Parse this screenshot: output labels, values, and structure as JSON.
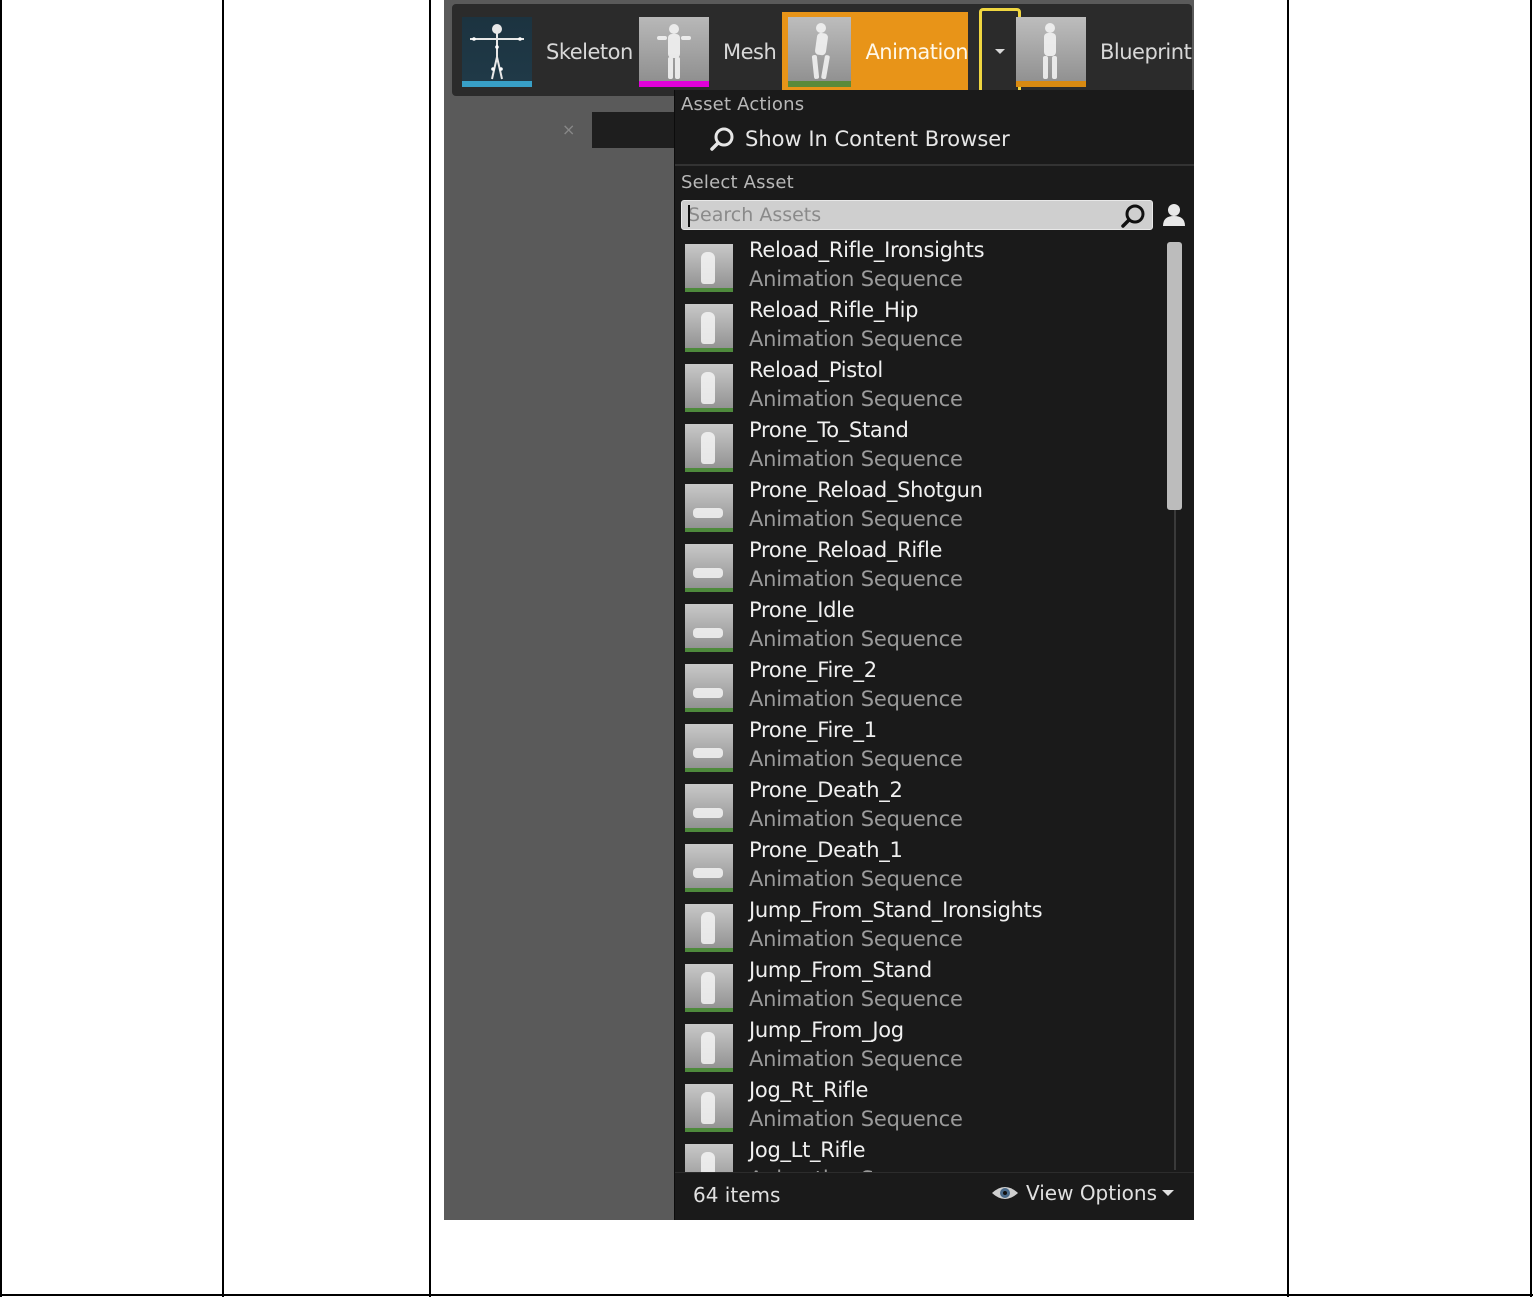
{
  "toolbar": {
    "skeleton_label": "Skeleton",
    "mesh_label": "Mesh",
    "animation_label": "Animation",
    "blueprint_label": "Blueprint",
    "dropdown_icon": "chevron-down-icon"
  },
  "editor": {
    "tab_close": "×"
  },
  "menu": {
    "asset_actions_heading": "Asset Actions",
    "show_in_content_browser": "Show In Content Browser",
    "select_asset_heading": "Select Asset",
    "search_placeholder": "Search Assets",
    "items": [
      {
        "name": "Reload_Rifle_Ironsights",
        "type": "Animation Sequence"
      },
      {
        "name": "Reload_Rifle_Hip",
        "type": "Animation Sequence"
      },
      {
        "name": "Reload_Pistol",
        "type": "Animation Sequence"
      },
      {
        "name": "Prone_To_Stand",
        "type": "Animation Sequence"
      },
      {
        "name": "Prone_Reload_Shotgun",
        "type": "Animation Sequence"
      },
      {
        "name": "Prone_Reload_Rifle",
        "type": "Animation Sequence"
      },
      {
        "name": "Prone_Idle",
        "type": "Animation Sequence"
      },
      {
        "name": "Prone_Fire_2",
        "type": "Animation Sequence"
      },
      {
        "name": "Prone_Fire_1",
        "type": "Animation Sequence"
      },
      {
        "name": "Prone_Death_2",
        "type": "Animation Sequence"
      },
      {
        "name": "Prone_Death_1",
        "type": "Animation Sequence"
      },
      {
        "name": "Jump_From_Stand_Ironsights",
        "type": "Animation Sequence"
      },
      {
        "name": "Jump_From_Stand",
        "type": "Animation Sequence"
      },
      {
        "name": "Jump_From_Jog",
        "type": "Animation Sequence"
      },
      {
        "name": "Jog_Rt_Rifle",
        "type": "Animation Sequence"
      },
      {
        "name": "Jog_Lt_Rifle",
        "type": "Animation Sequence"
      }
    ],
    "item_count": "64 items",
    "view_options": "View Options"
  },
  "colors": {
    "animation_active": "#e89418",
    "focus_outline": "#f0d640",
    "mesh_accent": "#e000d8",
    "skeleton_accent": "#38a0c8",
    "anim_accent": "#4e8a3c",
    "blueprint_accent": "#d88a12"
  }
}
